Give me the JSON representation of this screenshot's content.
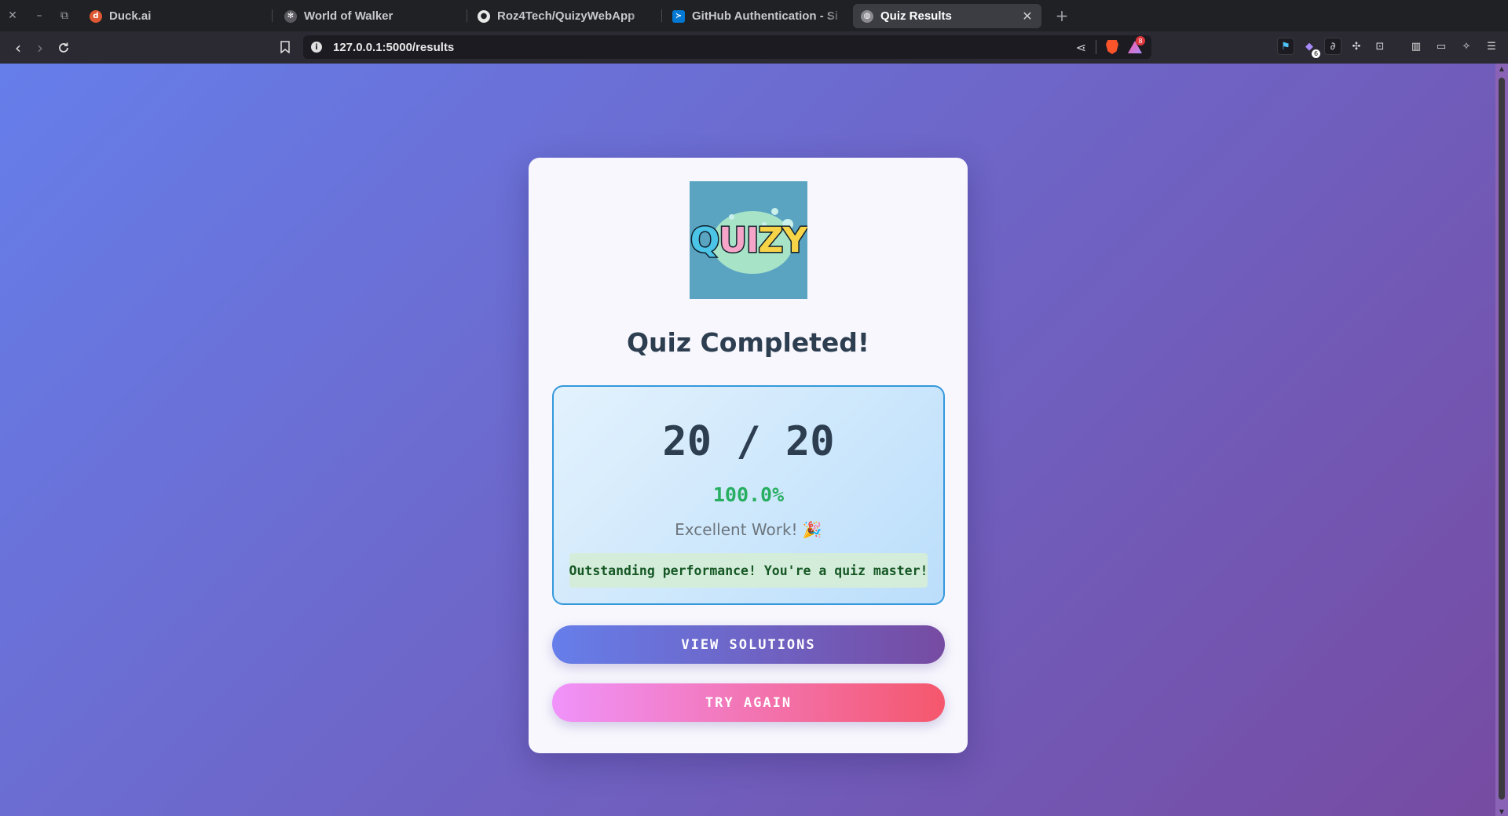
{
  "browser": {
    "tabs": [
      {
        "title": "Duck.ai",
        "icon": "duckduckgo-icon",
        "active": false
      },
      {
        "title": "World of Walker",
        "icon": "walker-icon",
        "active": false
      },
      {
        "title": "Roz4Tech/QuizyWebApp",
        "icon": "github-icon",
        "active": false
      },
      {
        "title": "GitHub Authentication - Si",
        "icon": "vscode-icon",
        "active": false
      },
      {
        "title": "Quiz Results",
        "icon": "globe-icon",
        "active": true
      }
    ],
    "url": "127.0.0.1:5000/results",
    "rewards_badge": "8",
    "extension_badge": "6"
  },
  "card": {
    "logo_text": [
      "Q",
      "U",
      "I",
      "Z",
      "Y"
    ],
    "title": "Quiz Completed!",
    "score": "20 / 20",
    "percentage": "100.0%",
    "rating": "Excellent Work! 🎉",
    "feedback": "Outstanding performance! You're a quiz master!",
    "buttons": {
      "view_solutions": "VIEW SOLUTIONS",
      "try_again": "TRY AGAIN"
    }
  },
  "colors": {
    "bg_start": "#667eea",
    "bg_end": "#764ba2",
    "title": "#2c3e50",
    "percent": "#27ae60",
    "score_border": "#3498db",
    "feedback_bg": "#d4edda",
    "feedback_text": "#155724",
    "retry_start": "#f093fb",
    "retry_end": "#f5576c"
  }
}
